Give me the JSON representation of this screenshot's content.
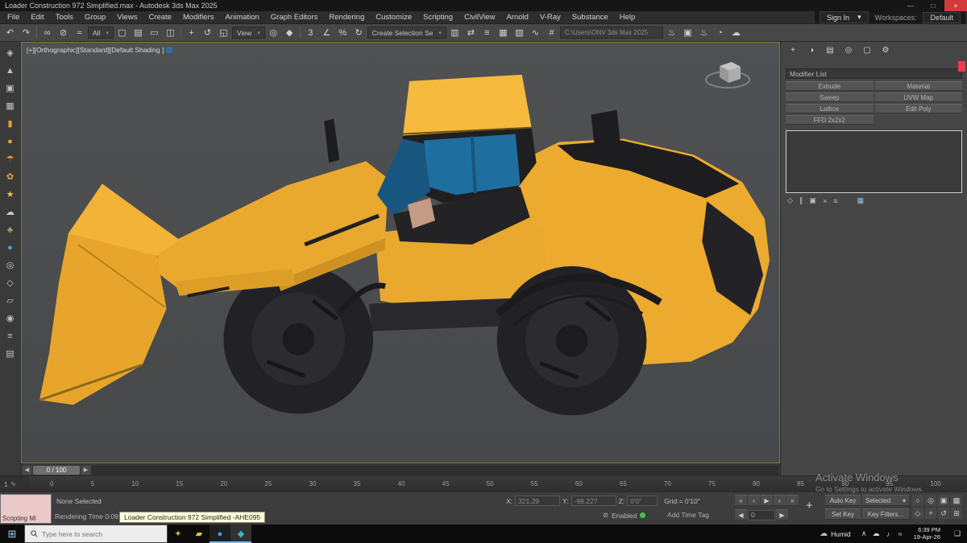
{
  "window": {
    "title": "Loader Construction 972 Simplified.max - Autodesk 3ds Max 2025",
    "controls": [
      {
        "n": "minimize-button",
        "g": "—"
      },
      {
        "n": "maximize-button",
        "g": "□"
      },
      {
        "n": "close-button",
        "g": "×"
      }
    ]
  },
  "menu": {
    "items": [
      "File",
      "Edit",
      "Tools",
      "Group",
      "Views",
      "Create",
      "Modifiers",
      "Animation",
      "Graph Editors",
      "Rendering",
      "Customize",
      "Scripting",
      "CivilView",
      "Arnold",
      "V-Ray",
      "Substance",
      "Help"
    ],
    "sign_in": "Sign In",
    "workspaces_label": "Workspaces:",
    "workspaces_value": "Default"
  },
  "toolbar": {
    "icons_history": [
      {
        "n": "undo-icon",
        "g": "↶"
      },
      {
        "n": "redo-icon",
        "g": "↷"
      }
    ],
    "icons_link": [
      {
        "n": "select-and-link-icon",
        "g": "∞"
      },
      {
        "n": "unlink-selection-icon",
        "g": "⊘"
      },
      {
        "n": "bind-to-space-warp-icon",
        "g": "≈"
      }
    ],
    "selection_filter": "All",
    "icons_select": [
      {
        "n": "select-object-icon",
        "g": "▢"
      },
      {
        "n": "select-by-name-icon",
        "g": "▤"
      },
      {
        "n": "selection-region-icon",
        "g": "▭"
      },
      {
        "n": "window-crossing-icon",
        "g": "◫"
      }
    ],
    "icons_transform": [
      {
        "n": "select-and-move-icon",
        "g": "+"
      },
      {
        "n": "select-and-rotate-icon",
        "g": "↺"
      },
      {
        "n": "select-and-scale-icon",
        "g": "◱"
      }
    ],
    "view_label": "View",
    "icons_pivot": [
      {
        "n": "use-pivot-point-icon",
        "g": "◎"
      },
      {
        "n": "select-and-manipulate-icon",
        "g": "◆"
      }
    ],
    "icons_snap": [
      {
        "n": "snaps-toggle-icon",
        "g": "3"
      },
      {
        "n": "angle-snap-icon",
        "g": "∠"
      },
      {
        "n": "percent-snap-icon",
        "g": "%"
      },
      {
        "n": "spinner-snap-icon",
        "g": "↻"
      }
    ],
    "create_selection_label": "Create Selection Se",
    "icons_manage": [
      {
        "n": "edit-named-selections-icon",
        "g": "▥"
      },
      {
        "n": "mirror-icon",
        "g": "⇄"
      },
      {
        "n": "align-icon",
        "g": "≡"
      },
      {
        "n": "layer-manager-icon",
        "g": "▦"
      },
      {
        "n": "toggle-ribbon-icon",
        "g": "▧"
      },
      {
        "n": "curve-editor-icon",
        "g": "∿"
      },
      {
        "n": "schematic-view-icon",
        "g": "#"
      }
    ],
    "path_field": "C:\\Users\\ONV  3ds Max 2025",
    "icons_render": [
      {
        "n": "render-setup-icon",
        "g": "♨"
      },
      {
        "n": "rendered-frame-icon",
        "g": "▣"
      },
      {
        "n": "render-production-icon",
        "g": "♨"
      },
      {
        "n": "render-iterative-icon",
        "g": "◔"
      },
      {
        "n": "cloud-render-icon",
        "g": "☁"
      }
    ]
  },
  "left_toolbar": {
    "icons": [
      {
        "n": "hand-tool-icon",
        "g": "◈",
        "c": "#c2c2c2"
      },
      {
        "n": "walkthrough-icon",
        "g": "▲",
        "c": "#c2c2c2"
      },
      {
        "n": "boxes-icon",
        "g": "▣",
        "c": "#c2c2c2"
      },
      {
        "n": "grid-icon",
        "g": "▦",
        "c": "#c2c2c2"
      },
      {
        "n": "cylinder-icon",
        "g": "▮",
        "c": "#e2a63a"
      },
      {
        "n": "sphere-icon",
        "g": "●",
        "c": "#e2a63a"
      },
      {
        "n": "umbrella-icon",
        "g": "☂",
        "c": "#df8f33"
      },
      {
        "n": "flower-icon",
        "g": "✿",
        "c": "#e2a63a"
      },
      {
        "n": "star-icon",
        "g": "★",
        "c": "#eac54d"
      },
      {
        "n": "cloud-icon",
        "g": "☁",
        "c": "#c9cdd1"
      },
      {
        "n": "club-icon",
        "g": "♣",
        "c": "#8fb268"
      },
      {
        "n": "droplet-icon",
        "g": "●",
        "c": "#4fa3d8"
      },
      {
        "n": "target-icon",
        "g": "◎",
        "c": "#c2c2c2"
      },
      {
        "n": "diamond-icon",
        "g": "◇",
        "c": "#c2c2c2"
      },
      {
        "n": "page-icon",
        "g": "▱",
        "c": "#c2c2c2"
      },
      {
        "n": "wire-sphere-icon",
        "g": "◉",
        "c": "#c2c2c2"
      },
      {
        "n": "list-icon",
        "g": "≡",
        "c": "#c2c2c2"
      },
      {
        "n": "layers-icon",
        "g": "▤",
        "c": "#c2c2c2"
      }
    ]
  },
  "viewport": {
    "label": "[+][Orthographic][Standard][Default Shading ]"
  },
  "command_panel": {
    "tabs": [
      {
        "n": "create-tab-icon",
        "g": "+"
      },
      {
        "n": "modify-tab-icon",
        "g": "◑"
      },
      {
        "n": "hierarchy-tab-icon",
        "g": "▤"
      },
      {
        "n": "motion-tab-icon",
        "g": "◎"
      },
      {
        "n": "display-tab-icon",
        "g": "▢"
      },
      {
        "n": "utilities-tab-icon",
        "g": "⚙"
      }
    ],
    "modifier_list": "Modifier List",
    "buttons": [
      {
        "l": "Extrude",
        "r": "Material"
      },
      {
        "l": "Sweep",
        "r": "UVW Map"
      },
      {
        "l": "Lattice",
        "r": "Edit Poly"
      },
      {
        "l": "FFD 2x2x2",
        "r": ""
      }
    ],
    "stack_icons": [
      {
        "n": "pin-stack-icon",
        "g": "◇"
      },
      {
        "n": "show-end-result-icon",
        "g": "∥"
      },
      {
        "n": "make-unique-icon",
        "g": "▣"
      },
      {
        "n": "remove-modifier-icon",
        "g": "×"
      },
      {
        "n": "configure-modifier-sets-icon",
        "g": "≡"
      }
    ],
    "highlight_icon": "▦"
  },
  "timeline": {
    "track_label": "1",
    "curve_icon": "∿",
    "slider_value": "0 / 100",
    "ticks": [
      "0",
      "5",
      "10",
      "15",
      "20",
      "25",
      "30",
      "35",
      "40",
      "45",
      "50",
      "55",
      "60",
      "65",
      "70",
      "75",
      "80",
      "85",
      "90",
      "95",
      "100"
    ]
  },
  "status": {
    "listener": "Scripting Mi",
    "selection": "None Selected",
    "render_time": "Rendering Time 0:09:17",
    "tooltip": "Loader Construction 972 Simplified -AHE095",
    "x_label": "X:",
    "x_value": "321.29",
    "y_label": "Y:",
    "y_value": "-98.227",
    "z_label": "Z:",
    "z_value": "0'0\"",
    "grid": "Grid = 0'10\"",
    "transport": [
      {
        "n": "go-to-start-button",
        "g": "«"
      },
      {
        "n": "previous-frame-button",
        "g": "‹"
      },
      {
        "n": "play-button",
        "g": "▶"
      },
      {
        "n": "next-frame-button",
        "g": "›"
      },
      {
        "n": "go-to-end-button",
        "g": "»"
      }
    ],
    "frame_value": "0",
    "auto_key": "Auto Key",
    "selected_dd": "Selected",
    "set_key": "Set Key",
    "key_filters": "Key Filters...",
    "add_time_tag": "Add Time Tag",
    "enabled": "Enabled",
    "nav_row1": [
      {
        "n": "zoom-icon",
        "g": "○"
      },
      {
        "n": "zoom-all-icon",
        "g": "◎"
      },
      {
        "n": "zoom-extents-icon",
        "g": "▣"
      },
      {
        "n": "zoom-extents-all-icon",
        "g": "▩"
      }
    ],
    "nav_row2": [
      {
        "n": "field-of-view-icon",
        "g": "◇"
      },
      {
        "n": "pan-view-icon",
        "g": "+"
      },
      {
        "n": "orbit-icon",
        "g": "↺"
      },
      {
        "n": "maximize-viewport-icon",
        "g": "⊞"
      }
    ]
  },
  "taskbar": {
    "search_placeholder": "Type here to search",
    "apps": [
      {
        "n": "cortana-icon",
        "g": "✦",
        "c": "#d8b23a",
        "cls": "tb-app"
      },
      {
        "n": "file-explorer-icon",
        "g": "▰",
        "c": "#e8c053",
        "cls": "tb-app"
      },
      {
        "n": "edge-browser-icon",
        "g": "●",
        "c": "#35a3e8",
        "cls": "tb-app active"
      },
      {
        "n": "3dsmax-app-icon",
        "g": "◆",
        "c": "#35b8c8",
        "cls": "tb-app active selected"
      }
    ],
    "weather_icon": "☁",
    "weather": "Humid",
    "tray_icons": [
      {
        "n": "tray-chevron-icon",
        "g": "∧"
      },
      {
        "n": "onedrive-icon",
        "g": "☁"
      },
      {
        "n": "volume-icon",
        "g": "♪"
      },
      {
        "n": "network-icon",
        "g": "≈"
      }
    ],
    "time": "6:39 PM",
    "date": "19-Apr-26",
    "action_center_icon": "❏"
  },
  "watermark": {
    "line1": "Activate Windows",
    "line2": "Go to Settings to activate Windows."
  }
}
